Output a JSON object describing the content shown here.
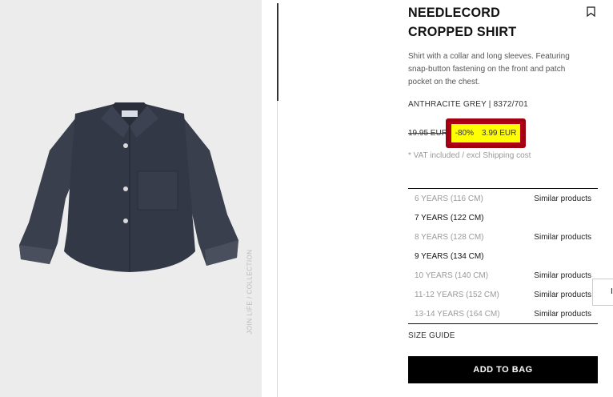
{
  "product": {
    "title": "NEEDLECORD CROPPED SHIRT",
    "description": "Shirt with a collar and long sleeves. Featuring snap-button fastening on the front and patch pocket on the chest.",
    "color_ref": "ANTHRACITE GREY | 8372/701",
    "brand_vertical": "JOIN LIFE / COLLECTION"
  },
  "price": {
    "old": "19.95 EUR",
    "discount": "-80%",
    "current": "3.99 EUR",
    "highlight_color": "#ffff00",
    "border_color": "#a00012"
  },
  "vat_note": "* VAT included / excl Shipping cost",
  "sizes": [
    {
      "label": "6 YEARS (116 CM)",
      "available": false,
      "similar": "Similar products"
    },
    {
      "label": "7 YEARS (122 CM)",
      "available": true,
      "similar": ""
    },
    {
      "label": "8 YEARS (128 CM)",
      "available": false,
      "similar": "Similar products"
    },
    {
      "label": "9 YEARS (134 CM)",
      "available": true,
      "similar": ""
    },
    {
      "label": "10 YEARS (140 CM)",
      "available": false,
      "similar": "Similar products"
    },
    {
      "label": "11-12 YEARS (152 CM)",
      "available": false,
      "similar": "Similar products"
    },
    {
      "label": "13-14 YEARS (164 CM)",
      "available": false,
      "similar": "Similar products"
    }
  ],
  "size_guide": "SIZE GUIDE",
  "add_to_bag": "ADD TO BAG",
  "icons": {
    "bookmark": "bookmark-icon"
  },
  "side_tab_glyph": "I"
}
